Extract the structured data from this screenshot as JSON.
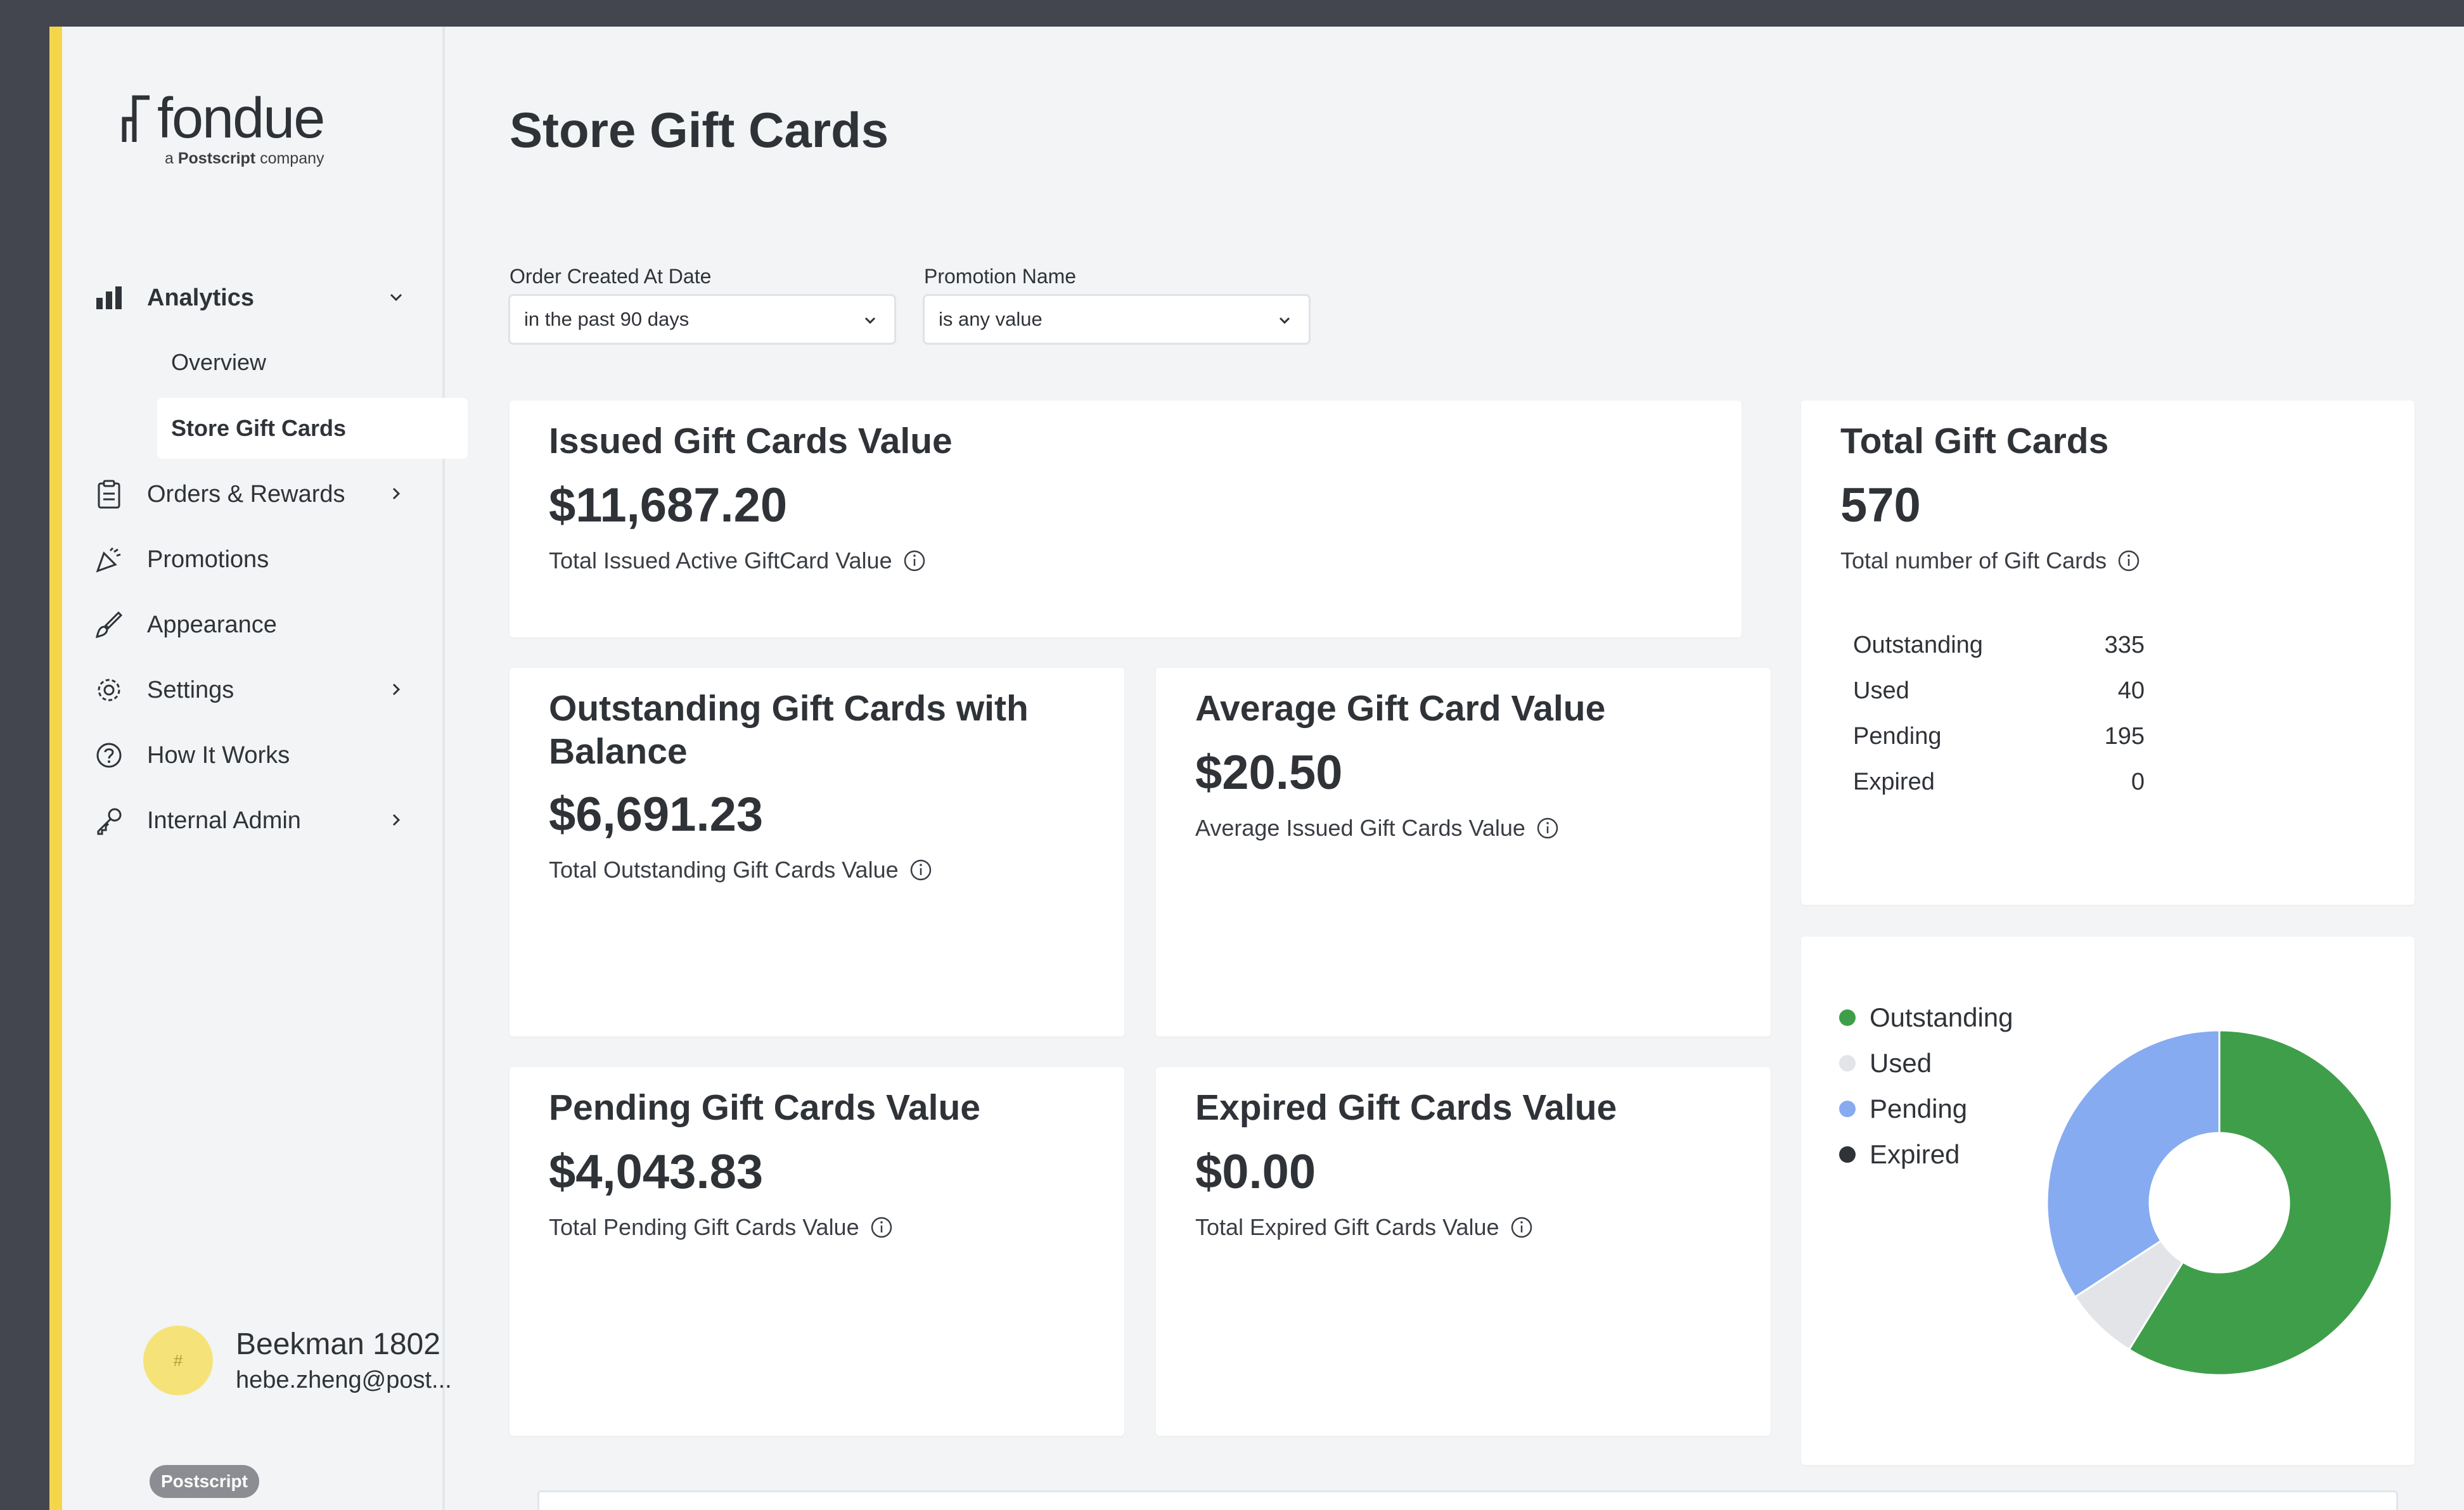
{
  "brand": {
    "name": "fondue",
    "tagline_prefix": "a",
    "tagline_brand": "Postscript",
    "tagline_suffix": "company"
  },
  "sidebar": {
    "items": [
      {
        "label": "Analytics",
        "icon": "bar-chart-icon",
        "expanded": true
      },
      {
        "label": "Overview"
      },
      {
        "label": "Store Gift Cards",
        "active": true
      },
      {
        "label": "Orders & Rewards",
        "icon": "clipboard-icon"
      },
      {
        "label": "Promotions",
        "icon": "party-popper-icon"
      },
      {
        "label": "Appearance",
        "icon": "paintbrush-icon"
      },
      {
        "label": "Settings",
        "icon": "gear-icon"
      },
      {
        "label": "How It Works",
        "icon": "help-circle-icon"
      },
      {
        "label": "Internal Admin",
        "icon": "key-icon"
      }
    ]
  },
  "user": {
    "name": "Beekman 1802",
    "email": "hebe.zheng@post...",
    "avatar_text": "#"
  },
  "footer_badge": "Postscript",
  "page": {
    "title": "Store Gift Cards"
  },
  "filters": {
    "date": {
      "label": "Order Created At Date",
      "value": "in the past 90 days"
    },
    "promotion": {
      "label": "Promotion Name",
      "value": "is any value"
    }
  },
  "cards": {
    "issued": {
      "title": "Issued Gift Cards Value",
      "value": "$11,687.20",
      "subtitle": "Total Issued Active GiftCard Value"
    },
    "outstanding": {
      "title_line1": "Outstanding Gift Cards with",
      "title_line2": "Balance",
      "value": "$6,691.23",
      "subtitle": "Total Outstanding Gift Cards Value"
    },
    "average": {
      "title": "Average Gift Card Value",
      "value": "$20.50",
      "subtitle": "Average Issued Gift Cards Value"
    },
    "pending": {
      "title": "Pending Gift Cards Value",
      "value": "$4,043.83",
      "subtitle": "Total Pending Gift Cards Value"
    },
    "expired": {
      "title": "Expired Gift Cards Value",
      "value": "$0.00",
      "subtitle": "Total Expired Gift Cards Value"
    },
    "total": {
      "title": "Total Gift Cards",
      "value": "570",
      "subtitle": "Total number of Gift Cards",
      "breakdown": [
        {
          "label": "Outstanding",
          "value": "335"
        },
        {
          "label": "Used",
          "value": "40"
        },
        {
          "label": "Pending",
          "value": "195"
        },
        {
          "label": "Expired",
          "value": "0"
        }
      ]
    }
  },
  "colors": {
    "accent": "#f5d64a",
    "outstanding": "#3f9e4a",
    "used": "#e3e4e7",
    "pending": "#86abf0",
    "expired": "#2f3338"
  },
  "chart_data": {
    "type": "pie",
    "categories": [
      "Outstanding",
      "Used",
      "Pending",
      "Expired"
    ],
    "values": [
      335,
      40,
      195,
      0
    ],
    "colors": [
      "#3f9e4a",
      "#e3e4e7",
      "#86abf0",
      "#2f3338"
    ],
    "legend": "left",
    "donut": true
  }
}
